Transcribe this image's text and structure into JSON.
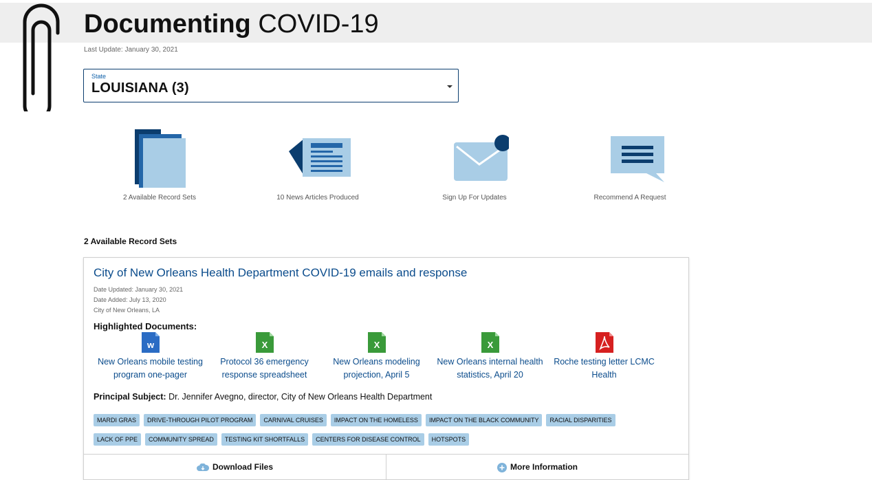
{
  "header": {
    "title_bold": "Documenting",
    "title_light": "COVID-19",
    "last_update": "Last Update: January 30, 2021"
  },
  "state_select": {
    "label": "State",
    "value": "LOUISIANA (3)"
  },
  "tiles": [
    {
      "caption": "2 Available Record Sets",
      "icon": "record-sets-icon"
    },
    {
      "caption": "10 News Articles Produced",
      "icon": "news-articles-icon"
    },
    {
      "caption": "Sign Up For Updates",
      "icon": "envelope-icon"
    },
    {
      "caption": "Recommend A Request",
      "icon": "chat-bubble-icon"
    }
  ],
  "section_heading": "2 Available Record Sets",
  "record": {
    "title": "City of New Orleans Health Department COVID-19 emails and response",
    "date_updated": "Date Updated: January 30, 2021",
    "date_added": "Date Added: July 13, 2020",
    "agency": "City of New Orleans, LA",
    "highlighted_label": "Highlighted Documents:",
    "documents": [
      {
        "name": "New Orleans mobile testing program one-pager",
        "type": "word-icon",
        "color": "#2b6cc4"
      },
      {
        "name": "Protocol 36 emergency response spreadsheet",
        "type": "excel-icon",
        "color": "#3a9a3a"
      },
      {
        "name": "New Orleans modeling projection, April 5",
        "type": "excel-icon",
        "color": "#3a9a3a"
      },
      {
        "name": "New Orleans internal health statistics, April 20",
        "type": "excel-icon",
        "color": "#3a9a3a"
      },
      {
        "name": "Roche testing letter LCMC Health",
        "type": "pdf-icon",
        "color": "#d62020"
      }
    ],
    "subject_label": "Principal Subject:",
    "subject_value": "Dr. Jennifer Avegno, director, City of New Orleans Health Department",
    "tags": [
      "MARDI GRAS",
      "DRIVE-THROUGH PILOT PROGRAM",
      "CARNIVAL CRUISES",
      "IMPACT ON THE HOMELESS",
      "IMPACT ON THE BLACK COMMUNITY",
      "RACIAL DISPARITIES",
      "LACK OF PPE",
      "COMMUNITY SPREAD",
      "TESTING KIT SHORTFALLS",
      "CENTERS FOR DISEASE CONTROL",
      "HOTSPOTS"
    ],
    "download_label": "Download Files",
    "more_info_label": "More Information"
  },
  "colors": {
    "brand_dark": "#0b3d6e",
    "brand_link": "#0b4c8c",
    "icon_light": "#a9cde6",
    "tag_bg": "#a9cde6"
  }
}
